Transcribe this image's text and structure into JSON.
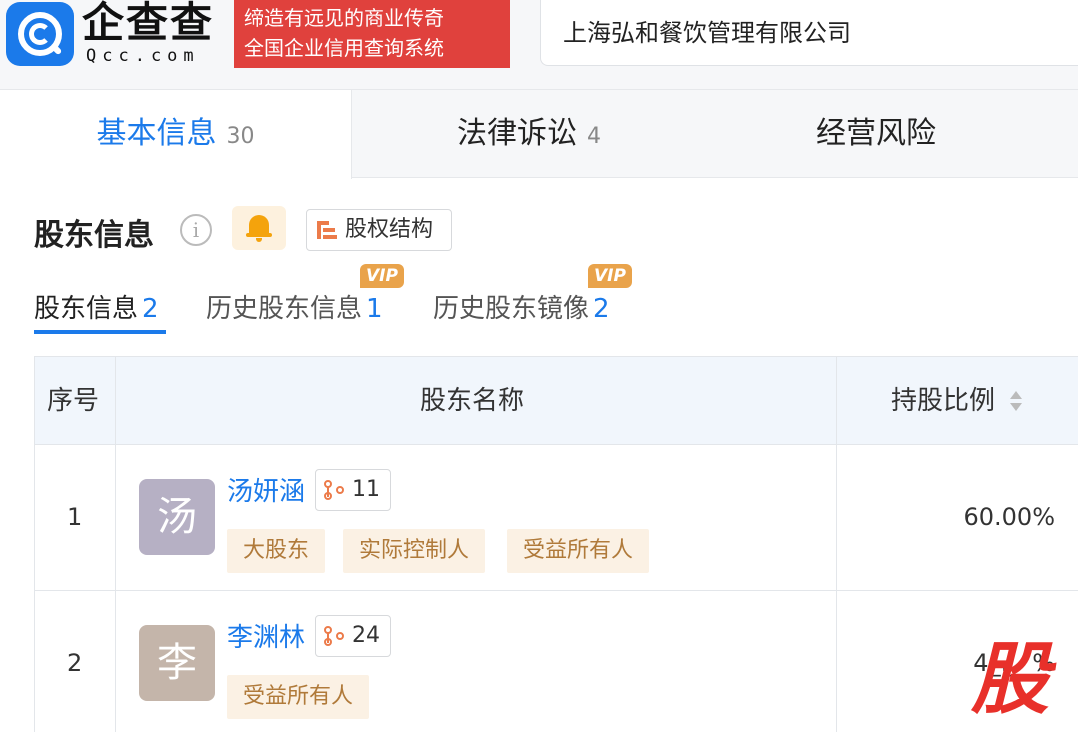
{
  "header": {
    "logo_text": "企查查",
    "logo_sub": "Qcc.com",
    "slogan_line1": "缔造有远见的商业传奇",
    "slogan_line2": "全国企业信用查询系统",
    "search_value": "上海弘和餐饮管理有限公司"
  },
  "tabs": [
    {
      "label": "基本信息",
      "count": "30"
    },
    {
      "label": "法律诉讼",
      "count": "4"
    },
    {
      "label": "经营风险",
      "count": ""
    }
  ],
  "section": {
    "title": "股东信息",
    "info_icon": "i",
    "equity_button": "股权结构"
  },
  "subtabs": [
    {
      "label": "股东信息",
      "count": "2"
    },
    {
      "label": "历史股东信息",
      "count": "1",
      "badge": "VIP"
    },
    {
      "label": "历史股东镜像",
      "count": "2",
      "badge": "VIP"
    }
  ],
  "table": {
    "headers": {
      "no": "序号",
      "name": "股东名称",
      "ratio": "持股比例"
    },
    "rows": [
      {
        "no": "1",
        "avatar": "汤",
        "name": "汤妍涵",
        "count": "11",
        "tags": [
          "大股东",
          "实际控制人",
          "受益所有人"
        ],
        "ratio": "60.00%"
      },
      {
        "no": "2",
        "avatar": "李",
        "name": "李渊林",
        "count": "24",
        "tags": [
          "受益所有人"
        ],
        "ratio": "4_.__%"
      }
    ]
  },
  "overlay": {
    "stamp": "股"
  },
  "colors": {
    "accent": "#1b7aea",
    "slogan_bg": "#e0413d",
    "tag_bg": "#fbf1e4",
    "tag_text": "#b07a3a",
    "vip": "#e9a34b"
  }
}
